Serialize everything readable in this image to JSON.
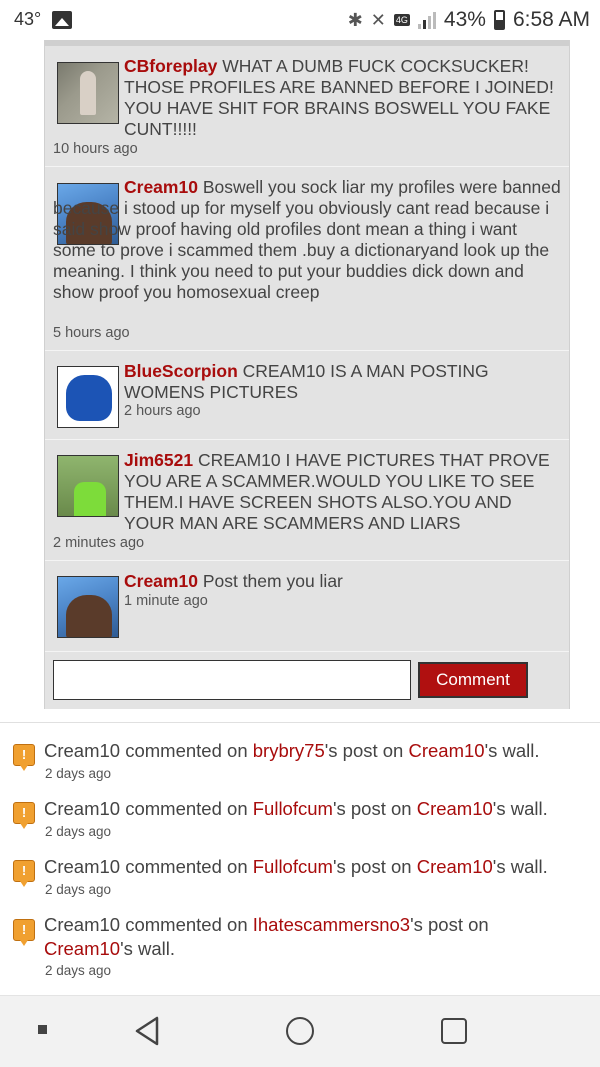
{
  "status_bar": {
    "temperature": "43°",
    "battery_percent": "43%",
    "time": "6:58 AM",
    "network_label": "4G",
    "lte_label": "LTE"
  },
  "comments": [
    {
      "user": "CBforeplay",
      "text": " WHAT A DUMB FUCK COCKSUCKER! THOSE PROFILES ARE BANNED BEFORE I JOINED! YOU HAVE SHIT FOR BRAINS BOSWELL YOU FAKE CUNT!!!!!",
      "time": "10 hours ago"
    },
    {
      "user": "Cream10",
      "text": " Boswell you sock liar my profiles were banned because i stood up for myself you obviously cant read because i said show proof having old profiles dont mean a thing i want some to prove i scammed them .buy a dictionaryand look up the meaning. I think you need to put your buddies dick down and show proof you homosexual creep",
      "time": "5 hours ago"
    },
    {
      "user": "BlueScorpion",
      "text": " CREAM10 IS A MAN POSTING WOMENS PICTURES",
      "time": "2 hours ago"
    },
    {
      "user": "Jim6521",
      "text": " CREAM10 I HAVE PICTURES THAT PROVE YOU ARE A SCAMMER.WOULD YOU LIKE TO SEE THEM.I HAVE SCREEN SHOTS ALSO.YOU AND YOUR MAN ARE SCAMMERS AND LIARS",
      "time": "2 minutes ago"
    },
    {
      "user": "Cream10",
      "text": " Post them you liar",
      "time": "1 minute ago"
    }
  ],
  "comment_form": {
    "input_value": "",
    "button_label": "Comment"
  },
  "activity": [
    {
      "actor": "Cream10",
      "verb": " commented on ",
      "post_owner": "brybry75",
      "mid": "'s post on ",
      "wall_owner": "Cream10",
      "end": "'s wall.",
      "time": "2 days ago"
    },
    {
      "actor": "Cream10",
      "verb": " commented on ",
      "post_owner": "Fullofcum",
      "mid": "'s post on ",
      "wall_owner": "Cream10",
      "end": "'s wall.",
      "time": "2 days ago"
    },
    {
      "actor": "Cream10",
      "verb": " commented on ",
      "post_owner": "Fullofcum",
      "mid": "'s post on ",
      "wall_owner": "Cream10",
      "end": "'s wall.",
      "time": "2 days ago"
    },
    {
      "actor": "Cream10",
      "verb": " commented on ",
      "post_owner": "Ihatescammersno3",
      "mid": "'s post on ",
      "wall_owner": "Cream10",
      "end": "'s wall.",
      "time": "2 days ago"
    }
  ],
  "colors": {
    "username_red": "#a80c0c",
    "button_red": "#b01010",
    "panel_gray": "#e3e3e3"
  },
  "icons": {
    "activity": "comment-notification-icon",
    "nav_back": "back-triangle-icon",
    "nav_home": "home-circle-icon",
    "nav_recent": "recent-apps-square-icon"
  }
}
